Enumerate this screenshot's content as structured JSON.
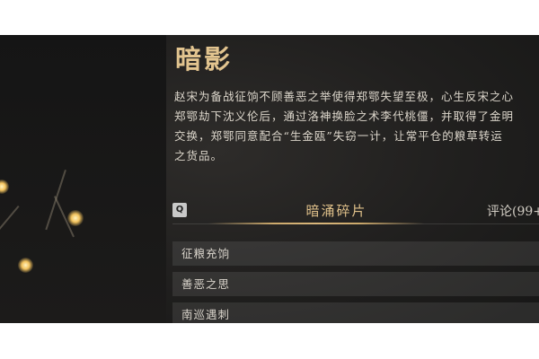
{
  "entry": {
    "title": "暗影",
    "description": "赵宋为备战征饷不顾善恶之举使得郑鄂失望至极，心生反宋之心\n郑鄂劫下沈义伦后，通过洛神换脸之术李代桃僵，并取得了金明\n交换，郑鄂同意配合“生金瓯”失窃一计，让常平仓的粮草转运\n之货品。"
  },
  "tabs": {
    "key_hint": "Q",
    "active_label": "暗涌碎片",
    "comments_label": "评论(99+"
  },
  "list": {
    "items": [
      {
        "label": "征粮充饷"
      },
      {
        "label": "善恶之思"
      },
      {
        "label": "南巡遇刺"
      }
    ]
  }
}
